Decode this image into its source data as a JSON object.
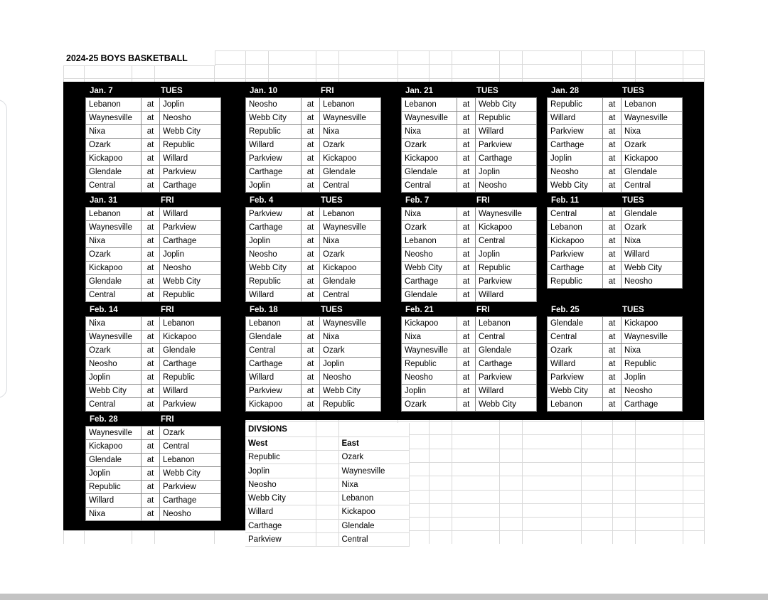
{
  "document": {
    "title": "2024-25 BOYS BASKETBALL"
  },
  "labels": {
    "at": "at"
  },
  "schedule": [
    {
      "date": "Jan. 7",
      "day": "TUES",
      "games": [
        {
          "away": "Lebanon",
          "home": "Joplin"
        },
        {
          "away": "Waynesville",
          "home": "Neosho"
        },
        {
          "away": "Nixa",
          "home": "Webb City"
        },
        {
          "away": "Ozark",
          "home": "Republic"
        },
        {
          "away": "Kickapoo",
          "home": "Willard"
        },
        {
          "away": "Glendale",
          "home": "Parkview"
        },
        {
          "away": "Central",
          "home": "Carthage"
        }
      ]
    },
    {
      "date": "Jan. 10",
      "day": "FRI",
      "games": [
        {
          "away": "Neosho",
          "home": "Lebanon"
        },
        {
          "away": "Webb City",
          "home": "Waynesville"
        },
        {
          "away": "Republic",
          "home": "Nixa"
        },
        {
          "away": "Willard",
          "home": "Ozark"
        },
        {
          "away": "Parkview",
          "home": "Kickapoo"
        },
        {
          "away": "Carthage",
          "home": "Glendale"
        },
        {
          "away": "Joplin",
          "home": "Central"
        }
      ]
    },
    {
      "date": "Jan. 21",
      "day": "TUES",
      "games": [
        {
          "away": "Lebanon",
          "home": "Webb City"
        },
        {
          "away": "Waynesville",
          "home": "Republic"
        },
        {
          "away": "Nixa",
          "home": "Willard"
        },
        {
          "away": "Ozark",
          "home": "Parkview"
        },
        {
          "away": "Kickapoo",
          "home": "Carthage"
        },
        {
          "away": "Glendale",
          "home": "Joplin"
        },
        {
          "away": "Central",
          "home": "Neosho"
        }
      ]
    },
    {
      "date": "Jan. 28",
      "day": "TUES",
      "games": [
        {
          "away": "Republic",
          "home": "Lebanon"
        },
        {
          "away": "Willard",
          "home": "Waynesville"
        },
        {
          "away": "Parkview",
          "home": "Nixa"
        },
        {
          "away": "Carthage",
          "home": "Ozark"
        },
        {
          "away": "Joplin",
          "home": "Kickapoo"
        },
        {
          "away": "Neosho",
          "home": "Glendale"
        },
        {
          "away": "Webb City",
          "home": "Central"
        }
      ]
    },
    {
      "date": "Jan. 31",
      "day": "FRI",
      "games": [
        {
          "away": "Lebanon",
          "home": "Willard"
        },
        {
          "away": "Waynesville",
          "home": "Parkview"
        },
        {
          "away": "Nixa",
          "home": "Carthage"
        },
        {
          "away": "Ozark",
          "home": "Joplin"
        },
        {
          "away": "Kickapoo",
          "home": "Neosho"
        },
        {
          "away": "Glendale",
          "home": "Webb City"
        },
        {
          "away": "Central",
          "home": "Republic"
        }
      ]
    },
    {
      "date": "Feb. 4",
      "day": "TUES",
      "games": [
        {
          "away": "Parkview",
          "home": "Lebanon"
        },
        {
          "away": "Carthage",
          "home": "Waynesville"
        },
        {
          "away": "Joplin",
          "home": "Nixa"
        },
        {
          "away": "Neosho",
          "home": "Ozark"
        },
        {
          "away": "Webb City",
          "home": "Kickapoo"
        },
        {
          "away": "Republic",
          "home": "Glendale"
        },
        {
          "away": "Willard",
          "home": "Central"
        }
      ]
    },
    {
      "date": "Feb. 7",
      "day": "FRI",
      "games": [
        {
          "away": "Nixa",
          "home": "Waynesville"
        },
        {
          "away": "Ozark",
          "home": "Kickapoo"
        },
        {
          "away": "Lebanon",
          "home": "Central"
        },
        {
          "away": "Neosho",
          "home": "Joplin"
        },
        {
          "away": "Webb City",
          "home": "Republic"
        },
        {
          "away": "Carthage",
          "home": "Parkview"
        },
        {
          "away": "Glendale",
          "home": "Willard"
        }
      ]
    },
    {
      "date": "Feb. 11",
      "day": "TUES",
      "games": [
        {
          "away": "Central",
          "home": "Glendale"
        },
        {
          "away": "Lebanon",
          "home": "Ozark"
        },
        {
          "away": "Kickapoo",
          "home": "Nixa"
        },
        {
          "away": "Parkview",
          "home": "Willard"
        },
        {
          "away": "Carthage",
          "home": "Webb City"
        },
        {
          "away": "Republic",
          "home": "Neosho"
        }
      ]
    },
    {
      "date": "Feb. 14",
      "day": "FRI",
      "games": [
        {
          "away": "Nixa",
          "home": "Lebanon"
        },
        {
          "away": "Waynesville",
          "home": "Kickapoo"
        },
        {
          "away": "Ozark",
          "home": "Glendale"
        },
        {
          "away": "Neosho",
          "home": "Carthage"
        },
        {
          "away": "Joplin",
          "home": "Republic"
        },
        {
          "away": "Webb City",
          "home": "Willard"
        },
        {
          "away": "Central",
          "home": "Parkview"
        }
      ]
    },
    {
      "date": "Feb. 18",
      "day": "TUES",
      "games": [
        {
          "away": "Lebanon",
          "home": "Waynesville"
        },
        {
          "away": "Glendale",
          "home": "Nixa"
        },
        {
          "away": "Central",
          "home": "Ozark"
        },
        {
          "away": "Carthage",
          "home": "Joplin"
        },
        {
          "away": "Willard",
          "home": "Neosho"
        },
        {
          "away": "Parkview",
          "home": "Webb City"
        },
        {
          "away": "Kickapoo",
          "home": "Republic"
        }
      ]
    },
    {
      "date": "Feb. 21",
      "day": "FRI",
      "games": [
        {
          "away": "Kickapoo",
          "home": "Lebanon"
        },
        {
          "away": "Nixa",
          "home": "Central"
        },
        {
          "away": "Waynesville",
          "home": "Glendale"
        },
        {
          "away": "Republic",
          "home": "Carthage"
        },
        {
          "away": "Neosho",
          "home": "Parkview"
        },
        {
          "away": "Joplin",
          "home": "Willard"
        },
        {
          "away": "Ozark",
          "home": "Webb City"
        }
      ]
    },
    {
      "date": "Feb. 25",
      "day": "TUES",
      "games": [
        {
          "away": "Glendale",
          "home": "Kickapoo"
        },
        {
          "away": "Central",
          "home": "Waynesville"
        },
        {
          "away": "Ozark",
          "home": "Nixa"
        },
        {
          "away": "Willard",
          "home": "Republic"
        },
        {
          "away": "Parkview",
          "home": "Joplin"
        },
        {
          "away": "Webb City",
          "home": "Neosho"
        },
        {
          "away": "Lebanon",
          "home": "Carthage"
        }
      ]
    },
    {
      "date": "Feb. 28",
      "day": "FRI",
      "games": [
        {
          "away": "Waynesville",
          "home": "Ozark"
        },
        {
          "away": "Kickapoo",
          "home": "Central"
        },
        {
          "away": "Glendale",
          "home": "Lebanon"
        },
        {
          "away": "Joplin",
          "home": "Webb City"
        },
        {
          "away": "Republic",
          "home": "Parkview"
        },
        {
          "away": "Willard",
          "home": "Carthage"
        },
        {
          "away": "Nixa",
          "home": "Neosho"
        }
      ]
    }
  ],
  "divisions": {
    "heading": "DIVSIONS",
    "west_label": "West",
    "east_label": "East",
    "west": [
      "Republic",
      "Joplin",
      "Neosho",
      "Webb City",
      "Willard",
      "Carthage",
      "Parkview"
    ],
    "east": [
      "Ozark",
      "Waynesville",
      "Nixa",
      "Lebanon",
      "Kickapoo",
      "Glendale",
      "Central"
    ]
  },
  "colors": {
    "backdrop": "#000000",
    "cell_border": "#8a8a8a",
    "grid_line": "#d9d9d9",
    "text": "#000000",
    "header_text": "#ffffff"
  }
}
